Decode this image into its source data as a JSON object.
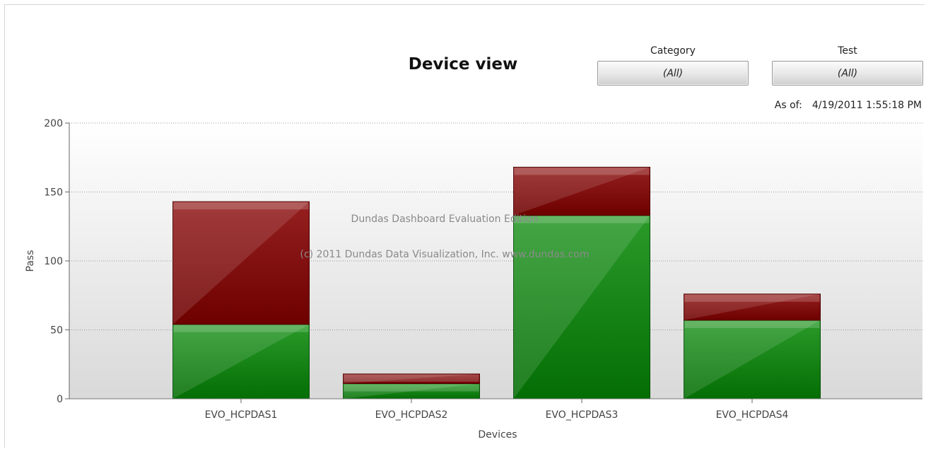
{
  "filters": {
    "category": {
      "label": "Category",
      "value": "(All)"
    },
    "test": {
      "label": "Test",
      "value": "(All)"
    }
  },
  "asof": {
    "label": "As of:",
    "value": "4/19/2011 1:55:18 PM"
  },
  "watermark": {
    "line1": "Dundas Dashboard Evaluation Edition",
    "line2": "(c) 2011 Dundas Data Visualization, Inc. www.dundas.com"
  },
  "colors": {
    "pass": "#0a7a0a",
    "fail": "#7a0000"
  },
  "chart_data": {
    "type": "bar",
    "stacked": true,
    "title": "Device view",
    "xlabel": "Devices",
    "ylabel": "Pass",
    "ylim": [
      0,
      200
    ],
    "yticks": [
      0,
      50,
      100,
      150,
      200
    ],
    "grid": true,
    "categories": [
      "EVO_HCPDAS1",
      "EVO_HCPDAS2",
      "EVO_HCPDAS3",
      "EVO_HCPDAS4"
    ],
    "series": [
      {
        "values": [
          54,
          11,
          133,
          57
        ]
      },
      {
        "values": [
          89,
          7,
          35,
          19
        ]
      }
    ]
  }
}
